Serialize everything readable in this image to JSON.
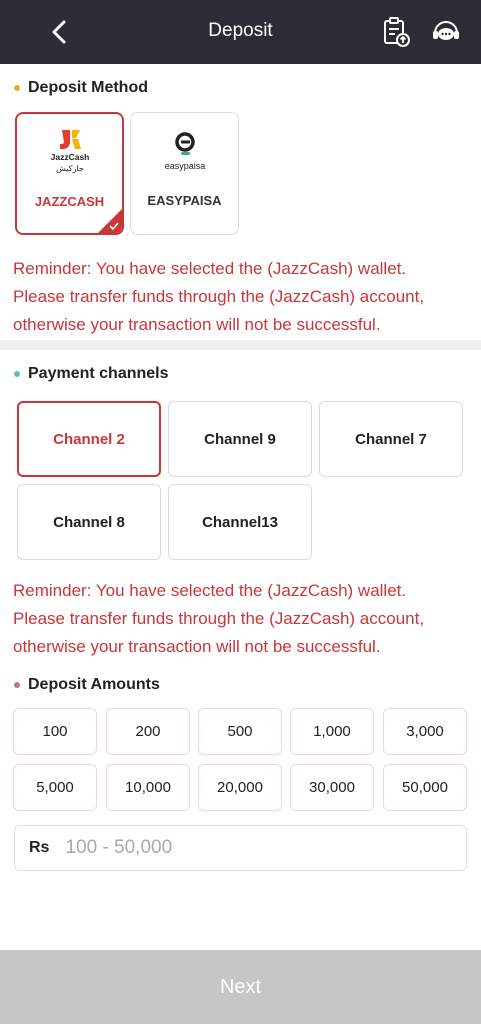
{
  "header": {
    "title": "Deposit",
    "back_icon": "chevron-left-icon",
    "record_icon": "clipboard-upload-icon",
    "service_icon": "customer-service-icon"
  },
  "deposit_method": {
    "title": "Deposit Method",
    "dot_color": "#f0a830",
    "items": [
      {
        "label": "JAZZCASH",
        "logo_text_top": "JazzCash",
        "logo_text_bottom": "جازکیش",
        "selected": true
      },
      {
        "label": "EASYPAISA",
        "logo_text": "easypaisa",
        "selected": false
      }
    ]
  },
  "reminder": {
    "lines": [
      "Reminder: You have selected the (JazzCash) wallet.",
      "Please transfer funds through the (JazzCash) account,",
      "otherwise your transaction will not be successful."
    ]
  },
  "payment_channels": {
    "title": "Payment channels",
    "dot_color": "#5bc2b0",
    "items": [
      {
        "label": "Channel 2",
        "selected": true
      },
      {
        "label": "Channel 9",
        "selected": false
      },
      {
        "label": "Channel 7",
        "selected": false
      },
      {
        "label": "Channel 8",
        "selected": false
      },
      {
        "label": "Channel13",
        "selected": false
      }
    ]
  },
  "deposit_amounts": {
    "title": "Deposit Amounts",
    "dot_color": "#b57a8c",
    "items": [
      "100",
      "200",
      "500",
      "1,000",
      "3,000",
      "5,000",
      "10,000",
      "20,000",
      "30,000",
      "50,000"
    ],
    "currency": "Rs",
    "placeholder": "100 - 50,000"
  },
  "next_button": {
    "label": "Next"
  },
  "colors": {
    "header_bg": "#2a2d35",
    "accent_red": "#c9363a",
    "disabled_button": "#c6c6c6"
  }
}
